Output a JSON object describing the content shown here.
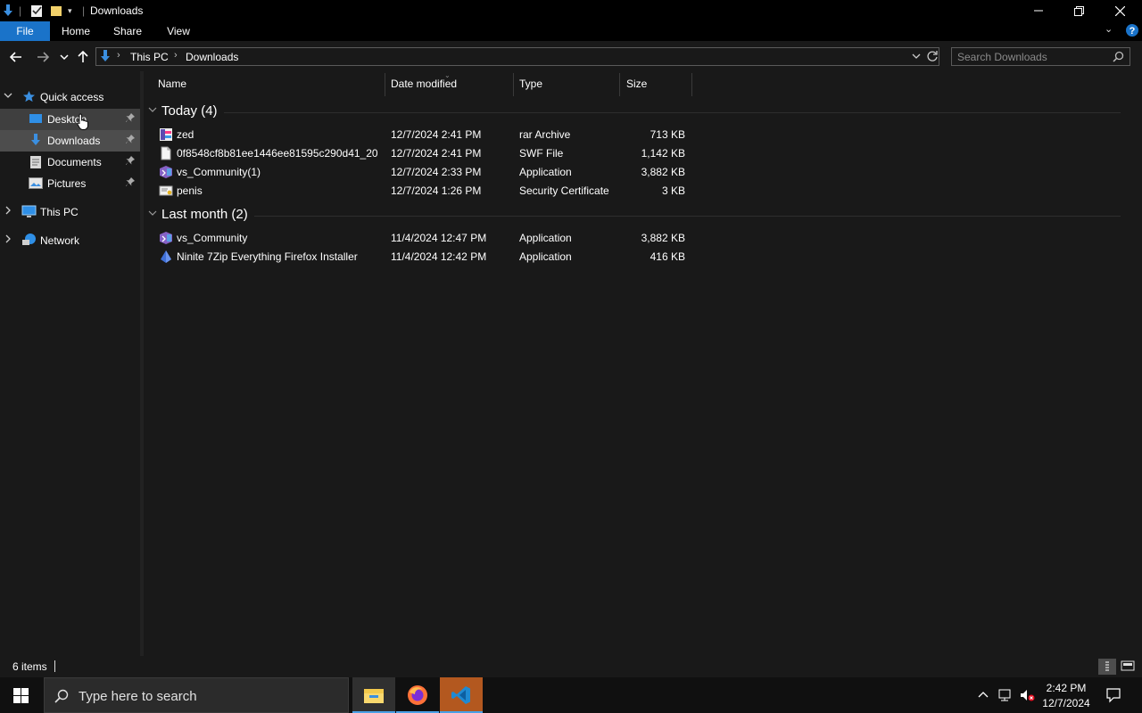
{
  "window": {
    "title": "Downloads",
    "tabs": [
      "File",
      "Home",
      "Share",
      "View"
    ]
  },
  "nav": {
    "breadcrumb": [
      "This PC",
      "Downloads"
    ],
    "search_placeholder": "Search Downloads"
  },
  "sidebar": {
    "quick_access": "Quick access",
    "items": [
      "Desktop",
      "Downloads",
      "Documents",
      "Pictures"
    ],
    "this_pc": "This PC",
    "network": "Network"
  },
  "columns": [
    "Name",
    "Date modified",
    "Type",
    "Size"
  ],
  "groups": [
    {
      "label": "Today (4)",
      "files": [
        {
          "name": "zed",
          "date": "12/7/2024 2:41 PM",
          "type": "rar Archive",
          "size": "713 KB",
          "icon": "rar-archive-icon"
        },
        {
          "name": "0f8548cf8b81ee1446ee81595c290d41_202...",
          "date": "12/7/2024 2:41 PM",
          "type": "SWF File",
          "size": "1,142 KB",
          "icon": "file-icon"
        },
        {
          "name": "vs_Community(1)",
          "date": "12/7/2024 2:33 PM",
          "type": "Application",
          "size": "3,882 KB",
          "icon": "visual-studio-installer-icon"
        },
        {
          "name": "penis",
          "date": "12/7/2024 1:26 PM",
          "type": "Security Certificate",
          "size": "3 KB",
          "icon": "certificate-icon"
        }
      ]
    },
    {
      "label": "Last month (2)",
      "files": [
        {
          "name": "vs_Community",
          "date": "11/4/2024 12:47 PM",
          "type": "Application",
          "size": "3,882 KB",
          "icon": "visual-studio-installer-icon"
        },
        {
          "name": "Ninite 7Zip Everything Firefox Installer",
          "date": "11/4/2024 12:42 PM",
          "type": "Application",
          "size": "416 KB",
          "icon": "ninite-icon"
        }
      ]
    }
  ],
  "status": {
    "item_count": "6 items"
  },
  "taskbar": {
    "search_placeholder": "Type here to search",
    "time": "2:42 PM",
    "date": "12/7/2024"
  },
  "colors": {
    "accent": "#1a73c9",
    "background": "#191919",
    "selected": "#4d4d4d",
    "hover": "#373737"
  }
}
